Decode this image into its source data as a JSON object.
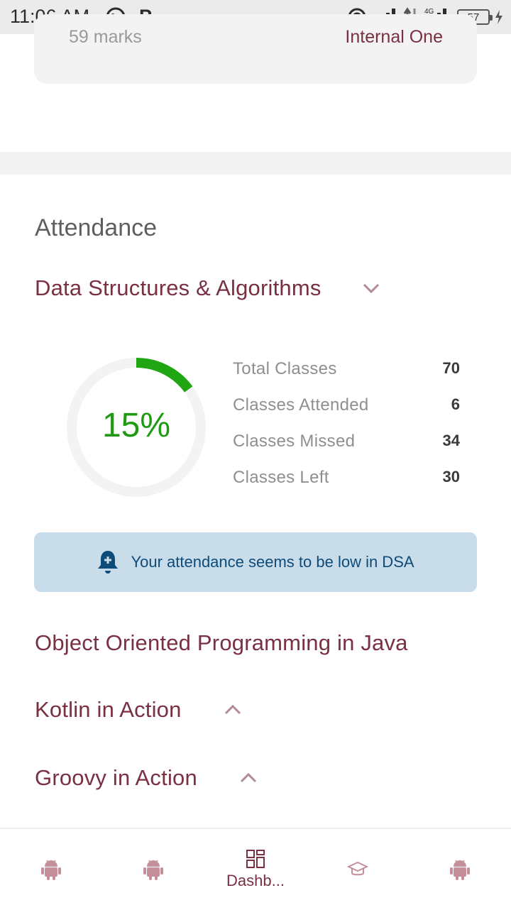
{
  "status_bar": {
    "time": "11:06 AM",
    "p_label": "P",
    "battery": "57"
  },
  "previous_card": {
    "marks": "59 marks",
    "exam": "Internal One"
  },
  "attendance": {
    "title": "Attendance",
    "selected_subject": "Data Structures & Algorithms",
    "percent": 15,
    "percent_label": "15%",
    "stats": [
      {
        "label": "Total Classes",
        "value": "70"
      },
      {
        "label": "Classes Attended",
        "value": "6"
      },
      {
        "label": "Classes Missed",
        "value": "34"
      },
      {
        "label": "Classes Left",
        "value": "30"
      }
    ],
    "alert": "Your attendance seems to be low in DSA",
    "other_subjects": [
      {
        "label": "Object Oriented Programming in Java",
        "chevron": "none"
      },
      {
        "label": "Kotlin in Action",
        "chevron": "up"
      },
      {
        "label": "Groovy in Action",
        "chevron": "up"
      }
    ]
  },
  "bottom_nav": {
    "items": [
      {
        "icon": "android-icon",
        "label": ""
      },
      {
        "icon": "android-icon",
        "label": ""
      },
      {
        "icon": "dashboard-icon",
        "label": "Dashb..."
      },
      {
        "icon": "graduation-cap-icon",
        "label": ""
      },
      {
        "icon": "android-icon",
        "label": ""
      }
    ]
  },
  "colors": {
    "accent": "#7a3043",
    "progress": "#1f9a12",
    "alert_bg": "#c9dcea",
    "alert_text": "#0d4b78"
  }
}
